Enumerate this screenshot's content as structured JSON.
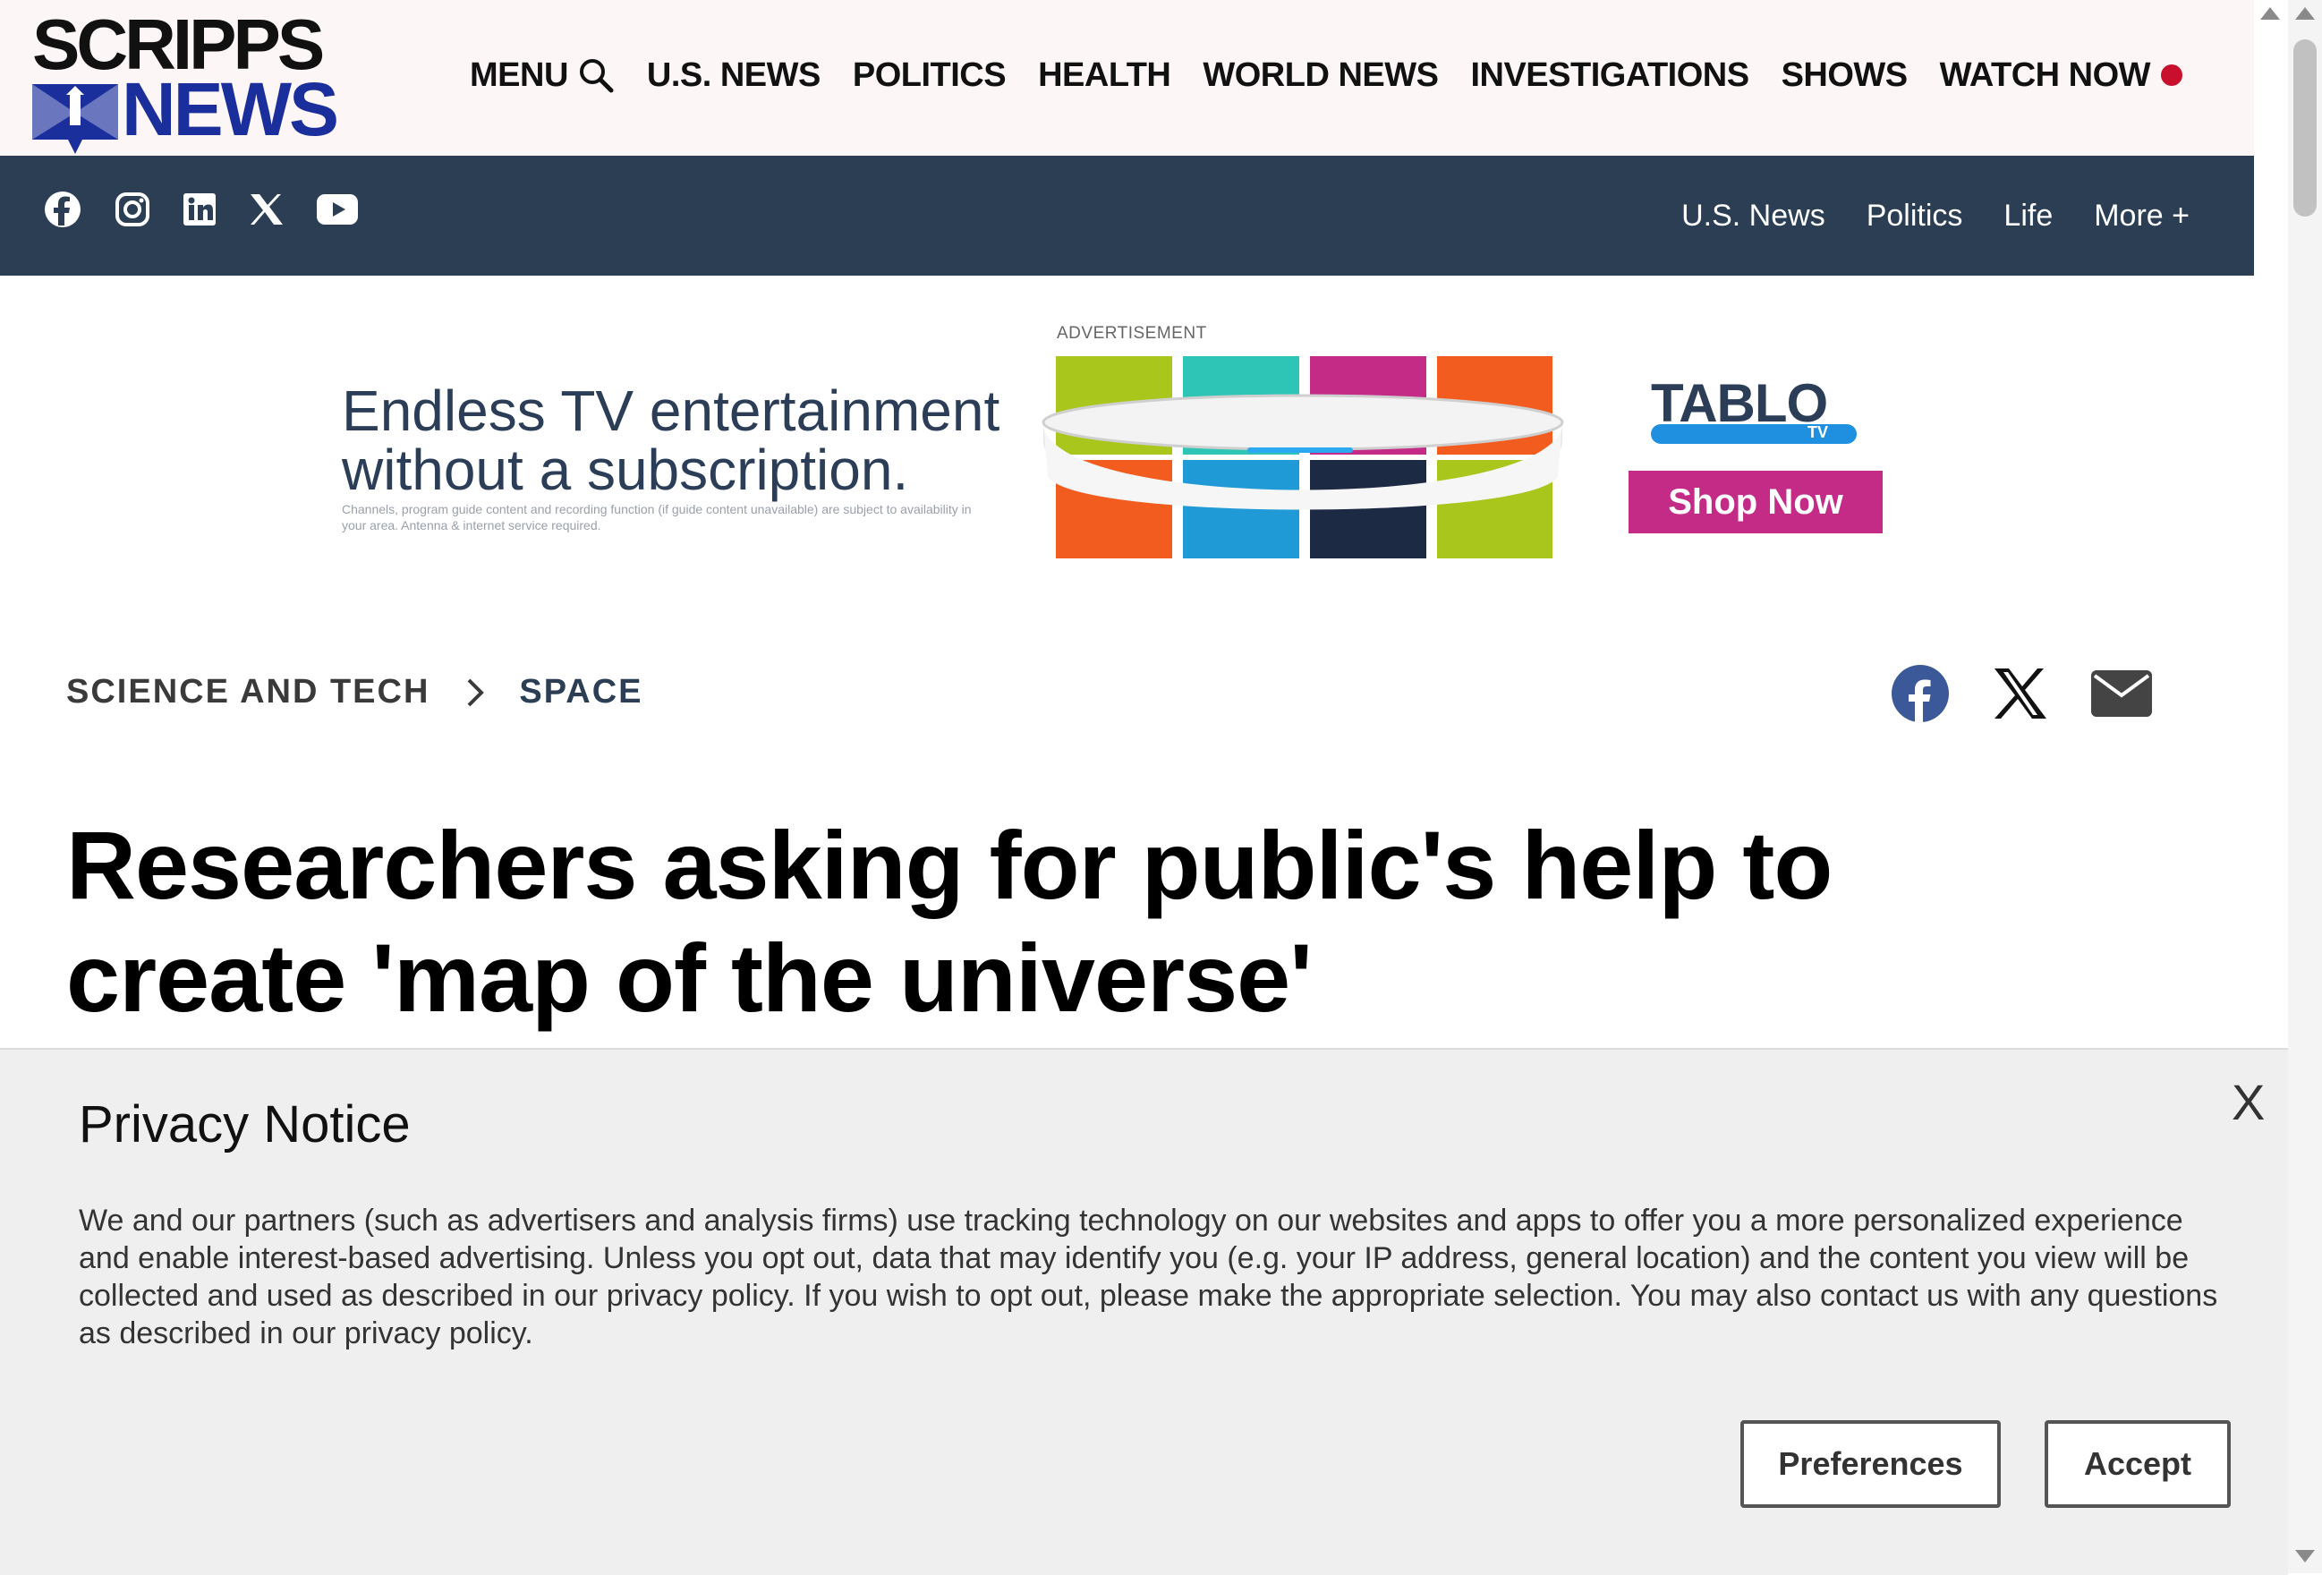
{
  "brand": {
    "logo_line1": "SCRIPPS",
    "logo_line2": "NEWS",
    "logo_color": "#1b2f9c"
  },
  "main_nav": {
    "menu_label": "MENU",
    "items": [
      "U.S. NEWS",
      "POLITICS",
      "HEALTH",
      "WORLD NEWS",
      "INVESTIGATIONS",
      "SHOWS"
    ],
    "watch_now": "WATCH NOW",
    "live_color": "#c8102e"
  },
  "sub_nav": {
    "background": "#2b3e54",
    "social_icons": [
      "facebook-icon",
      "instagram-icon",
      "linkedin-icon",
      "x-icon",
      "youtube-icon"
    ],
    "links": [
      "U.S. News",
      "Politics",
      "Life",
      "More +"
    ]
  },
  "ad": {
    "label": "ADVERTISEMENT",
    "headline_line1": "Endless TV entertainment",
    "headline_line2": "without a subscription.",
    "fine_print": "Channels, program guide content and recording function (if guide content unavailable) are subject to availability in your area. Antenna & internet service required.",
    "brand": "TABLO",
    "brand_sub": "TV",
    "cta": "Shop Now",
    "cta_color": "#c32b86"
  },
  "breadcrumb": {
    "parent": "SCIENCE AND TECH",
    "current": "SPACE"
  },
  "share": {
    "icons": [
      "facebook-share-icon",
      "x-share-icon",
      "email-share-icon"
    ]
  },
  "article": {
    "headline": "Researchers asking for public's help to create 'map of the universe'"
  },
  "privacy_notice": {
    "title": "Privacy Notice",
    "close_label": "X",
    "body": "We and our partners (such as advertisers and analysis firms) use tracking technology on our websites and apps to offer you a more personalized experience and enable interest-based advertising. Unless you opt out, data that may identify you (e.g. your IP address, general location) and the content you view will be collected and used as described in our privacy policy. If you wish to opt out, please make the appropriate selection. You may also contact us with any questions as described in our privacy policy.",
    "preferences_label": "Preferences",
    "accept_label": "Accept"
  }
}
